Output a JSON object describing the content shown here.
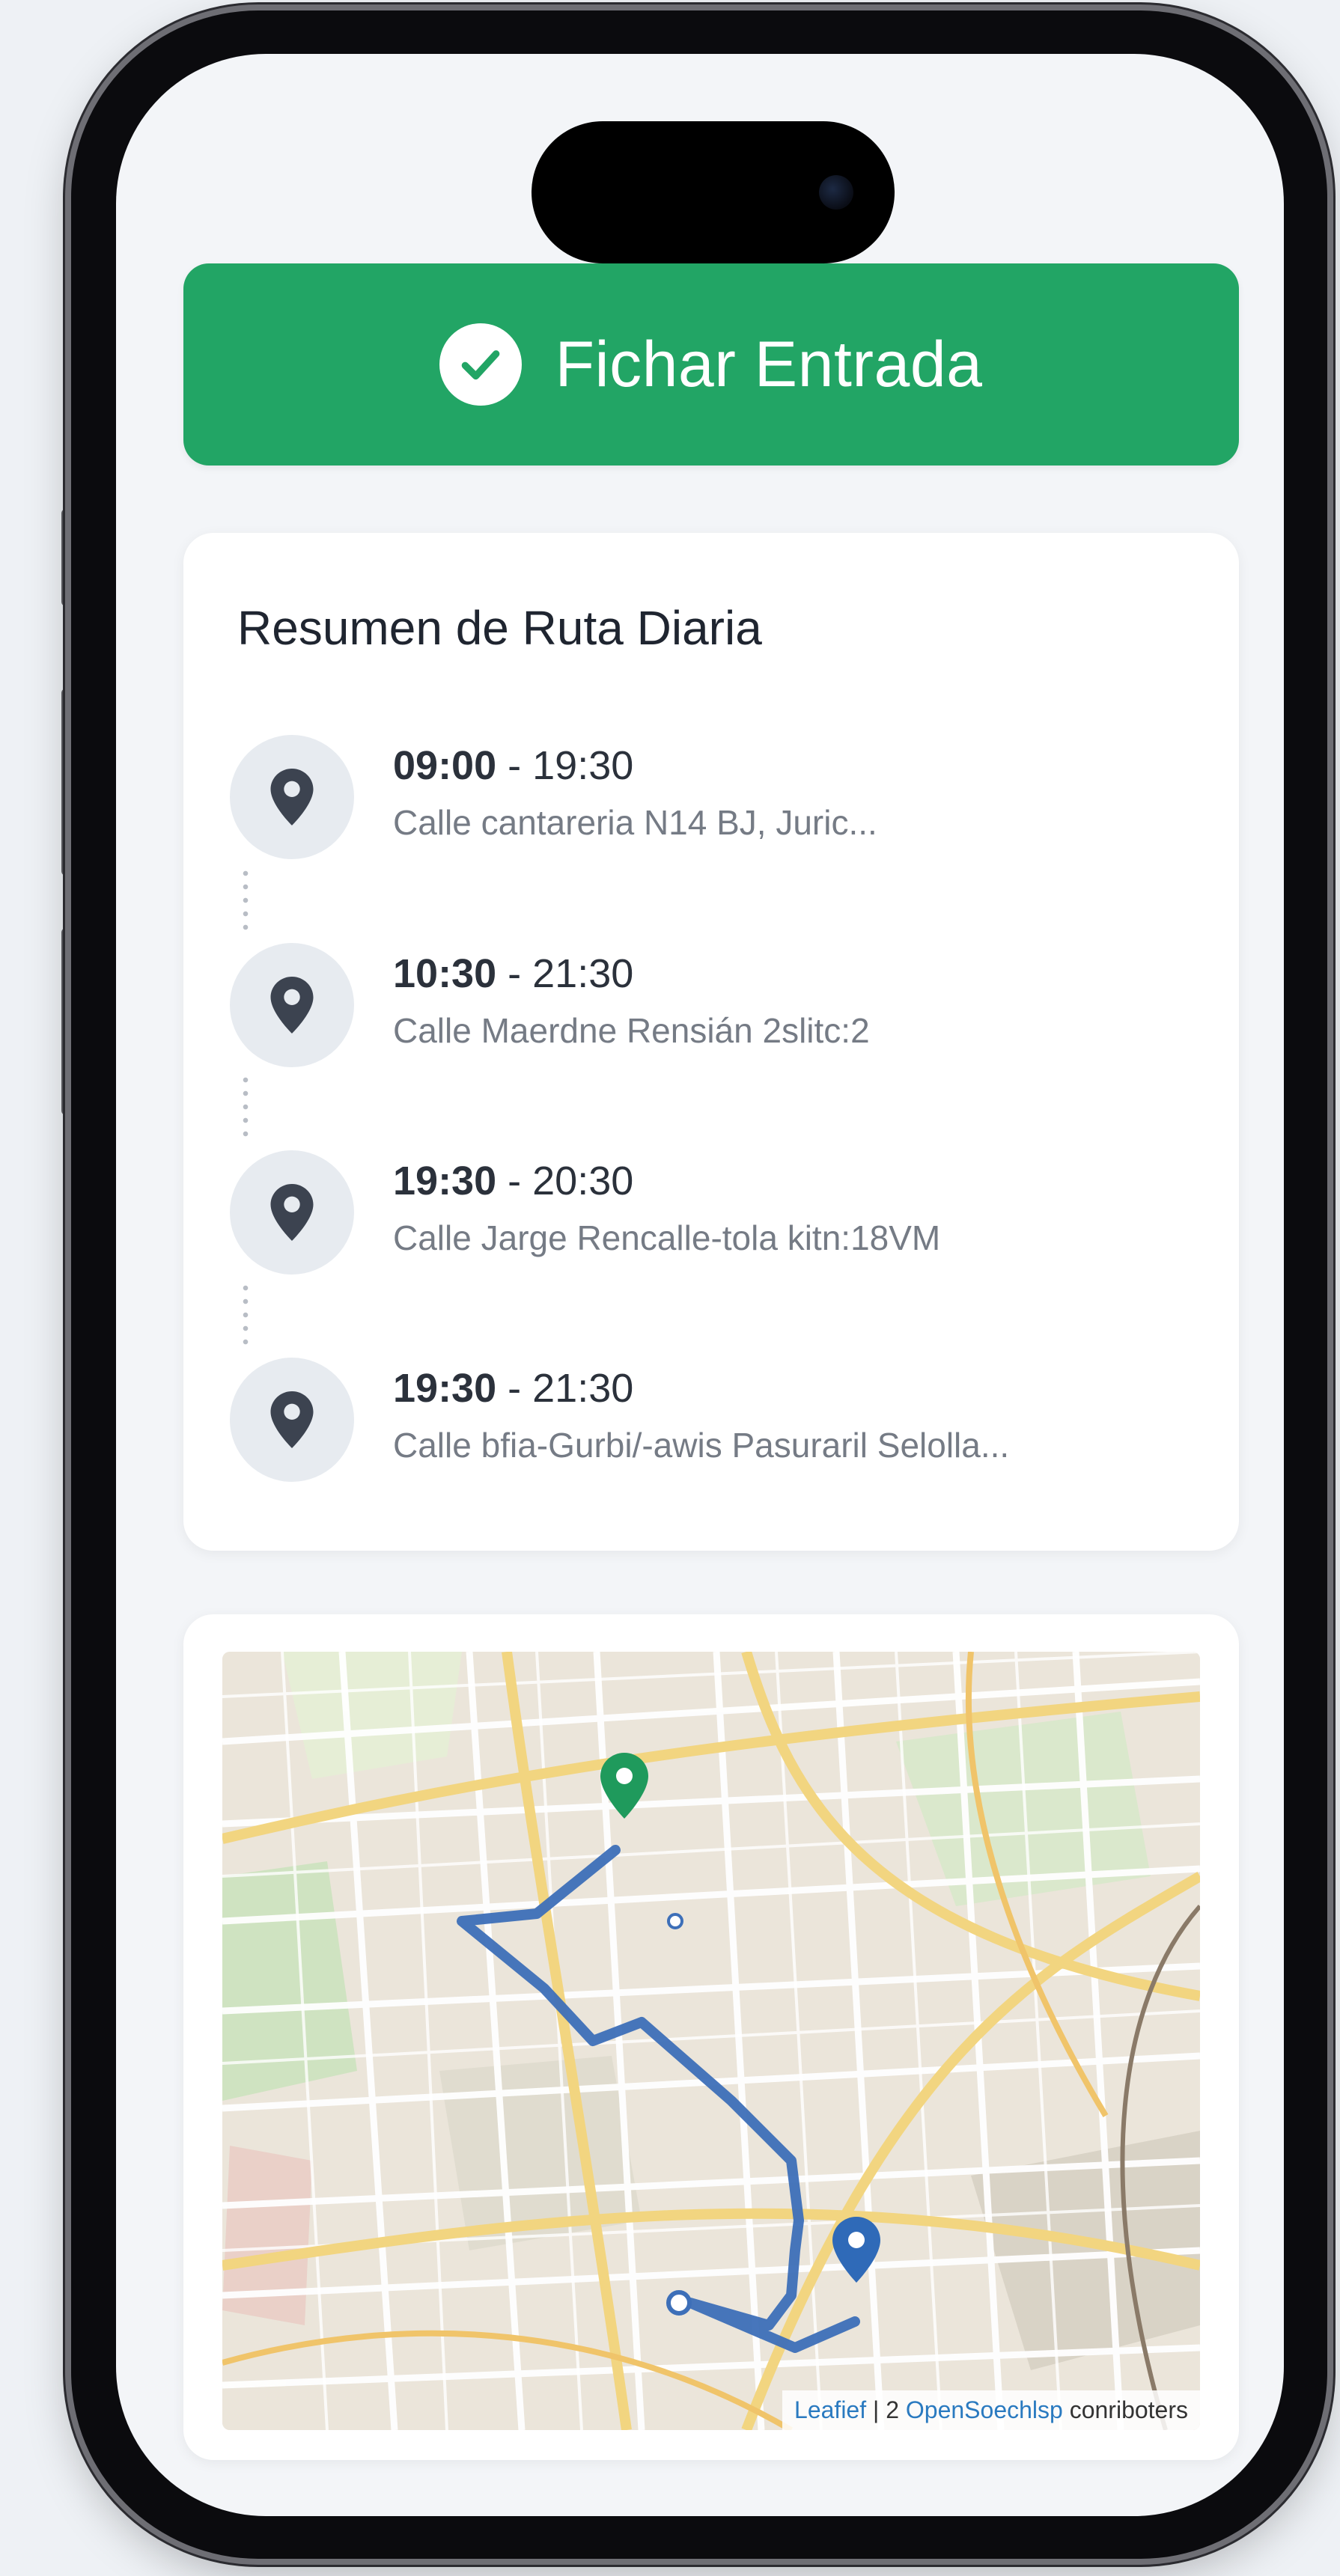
{
  "checkin": {
    "label": "Fichar Entrada",
    "icon": "check-circle-icon",
    "color": "#22a565"
  },
  "route_summary": {
    "title": "Resumen de Ruta Diaria",
    "stops": [
      {
        "start": "09:00",
        "separator": " - ",
        "end": "19:30",
        "address": "Calle cantareria N14  BJ, Juric..."
      },
      {
        "start": "10:30",
        "separator": " - ",
        "end": "21:30",
        "address": "Calle Maerdne Rensián 2slitc:2"
      },
      {
        "start": "19:30",
        "separator": " - ",
        "end": "20:30",
        "address": "Calle Jarge Rencalle-tola kitn:18VM"
      },
      {
        "start": "19:30",
        "separator": " - ",
        "end": "21:30",
        "address": "Calle bfia-Gurbi/-awis Pasuraril Selolla..."
      }
    ]
  },
  "map": {
    "attribution_leaflet": "Leafief",
    "attribution_sep": " | 2 ",
    "attribution_osm": "OpenSoechlsp",
    "attribution_rest": " conriboters",
    "start_marker_color": "#1f9a5c",
    "end_marker_color": "#2f6ab8",
    "route_color": "#3d6fb8"
  }
}
